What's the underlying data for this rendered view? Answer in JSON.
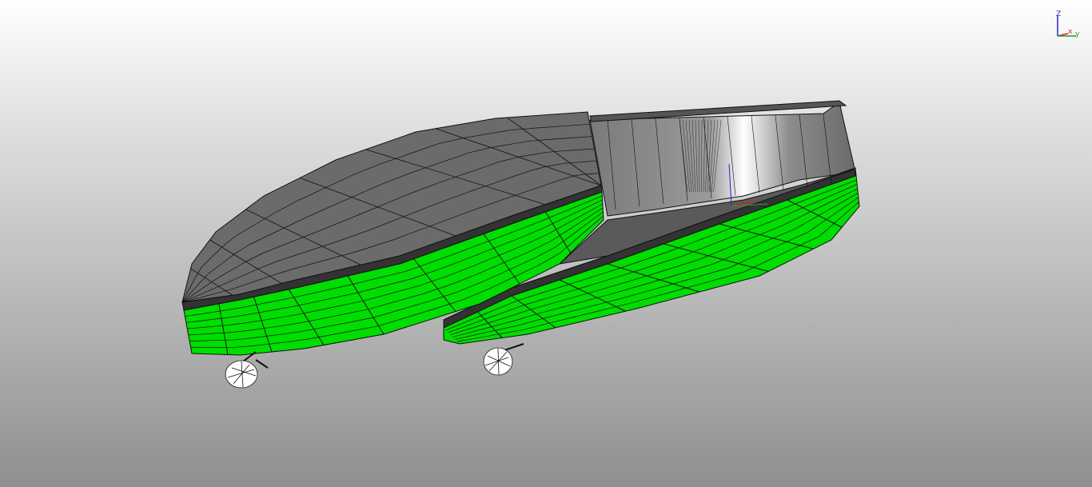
{
  "viewport": {
    "background_top": "#ffffff",
    "background_bottom": "#8f8f8f"
  },
  "model": {
    "hull_color": "#00dd00",
    "deck_color": "#6b6b6b",
    "interior_color": "#9a9a9a",
    "wire_color": "#111111"
  },
  "triad": {
    "z_label": "Z",
    "x_label": "x",
    "y_label": "y",
    "z_color": "#2222cc",
    "x_color": "#cc2222",
    "y_color": "#229922"
  }
}
